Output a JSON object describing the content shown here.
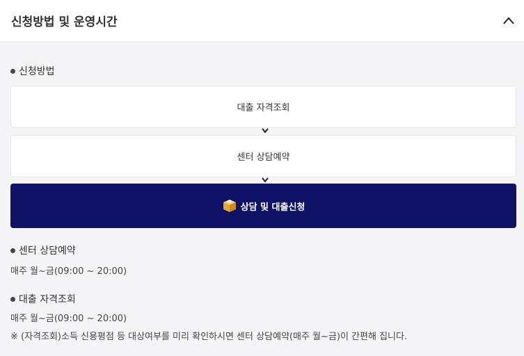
{
  "header": {
    "title": "신청방법 및 운영시간"
  },
  "apply": {
    "label": "신청방법",
    "steps": [
      "대출 자격조회",
      "센터 상담예약"
    ],
    "cta_label": "상담 및 대출신청"
  },
  "center": {
    "label": "센터 상담예약",
    "hours": "매주 월~금(09:00 ~ 20:00)"
  },
  "loan": {
    "label": "대출 자격조회",
    "hours": "매주 월~금(09:00 ~ 20:00)"
  },
  "note": "※ (자격조회)소득 신용평점 등 대상여부를 미리 확인하시면 센터 상담예약(매주 월~금)이 간편해 집니다.",
  "colors": {
    "cta_bg": "#0f1166",
    "page_bg": "#f5f5f7"
  },
  "icons": {
    "collapse": "chevron-up-icon",
    "step_arrow": "chevron-down-icon",
    "cta": "box-icon"
  }
}
